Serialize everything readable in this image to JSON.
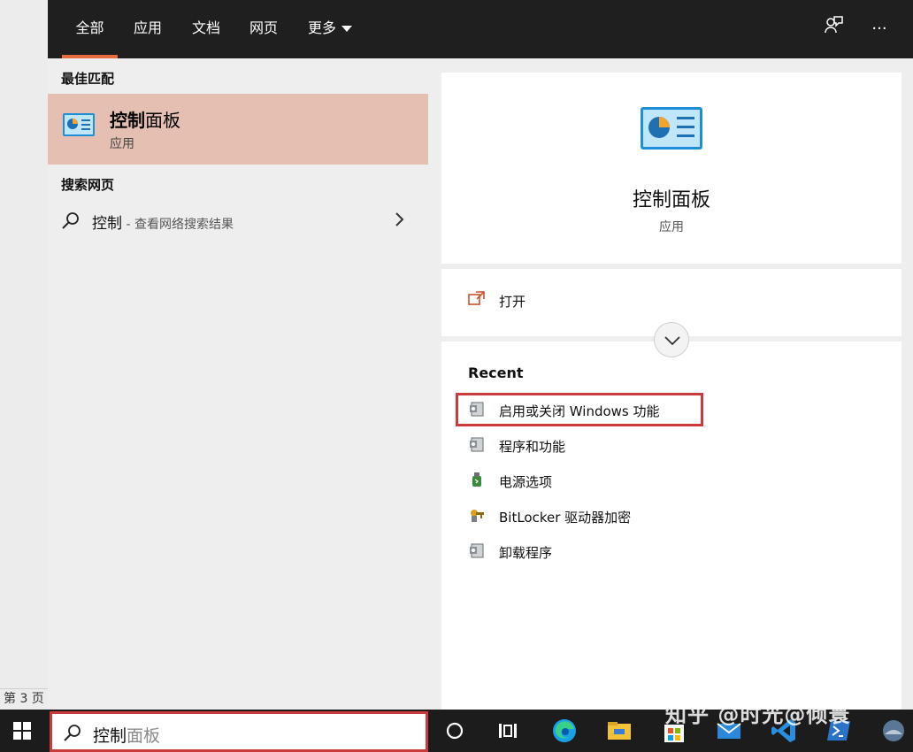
{
  "background": {
    "page_label": "第 3 页"
  },
  "tabs": [
    {
      "label": "全部"
    },
    {
      "label": "应用"
    },
    {
      "label": "文档"
    },
    {
      "label": "网页"
    },
    {
      "label": "更多"
    }
  ],
  "top_icons": {
    "feedback": "feedback-icon",
    "more": "···"
  },
  "left": {
    "best_match_title": "最佳匹配",
    "best_match": {
      "name_bold": "控制",
      "name_rest": "面板",
      "type": "应用"
    },
    "web_title": "搜索网页",
    "web_result": {
      "query": "控制",
      "suffix": " - 查看网络搜索结果"
    }
  },
  "right": {
    "app_name": "控制面板",
    "app_type": "应用",
    "open_label": "打开",
    "recent_title": "Recent",
    "recent_items": [
      {
        "label": "启用或关闭 Windows 功能",
        "icon": "programs-icon"
      },
      {
        "label": "程序和功能",
        "icon": "programs-icon"
      },
      {
        "label": "电源选项",
        "icon": "power-options-icon"
      },
      {
        "label": "BitLocker 驱动器加密",
        "icon": "bitlocker-icon"
      },
      {
        "label": "卸载程序",
        "icon": "programs-icon"
      }
    ]
  },
  "taskbar": {
    "search_typed": "控制",
    "search_suggestion": "面板",
    "watermark": "知乎 @时光@倾寰"
  },
  "colors": {
    "accent": "#e66c3f",
    "best_match_bg": "#e5bfb1",
    "highlight": "#cc3b3b"
  }
}
